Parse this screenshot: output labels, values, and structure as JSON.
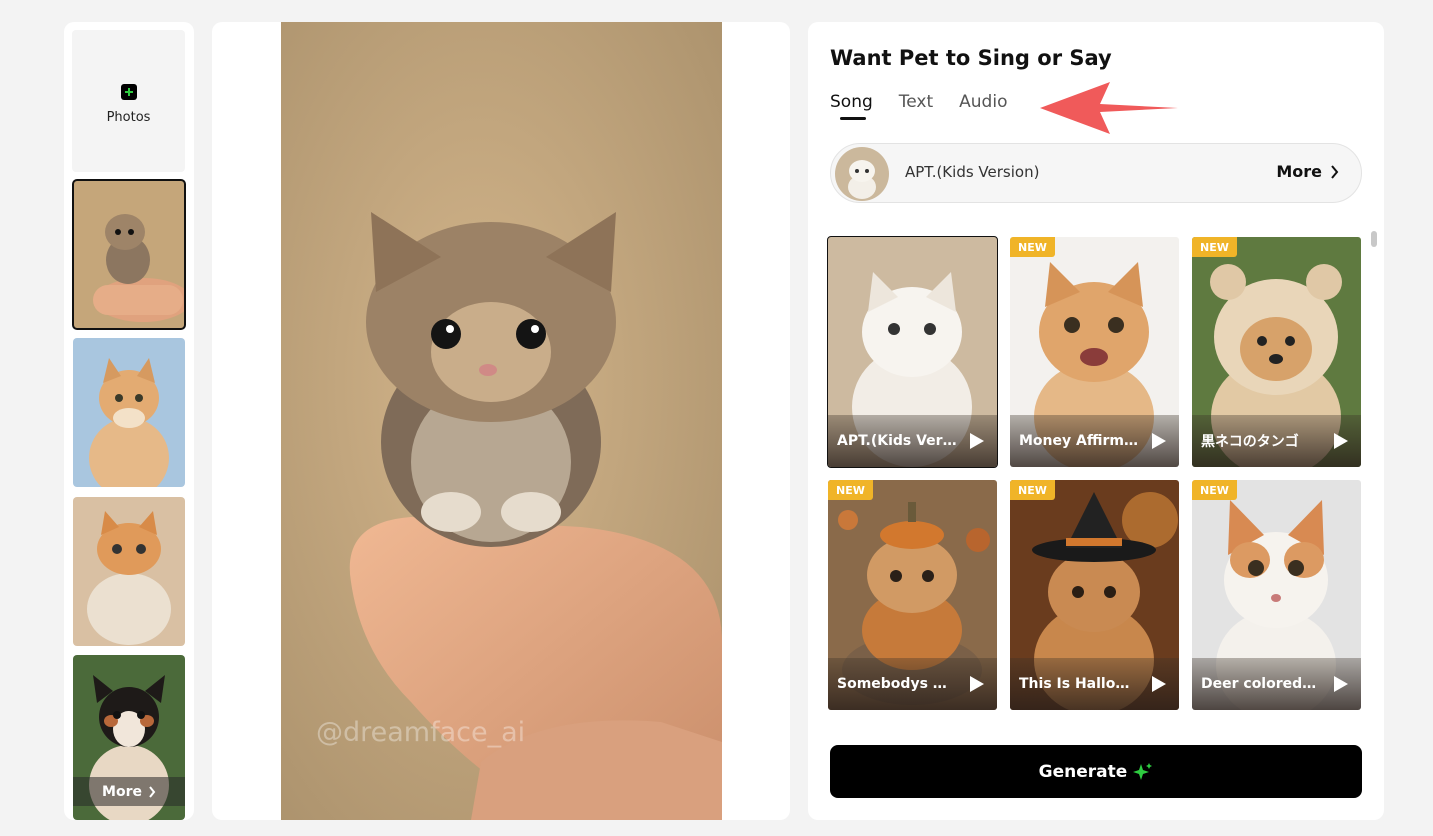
{
  "sidebar": {
    "upload_label": "Photos",
    "more_label": "More"
  },
  "preview": {
    "watermark": "@dreamface_ai"
  },
  "panel": {
    "title": "Want Pet to Sing or Say",
    "tabs": [
      {
        "label": "Song",
        "active": true
      },
      {
        "label": "Text",
        "active": false
      },
      {
        "label": "Audio",
        "active": false
      }
    ],
    "selected_song": "APT.(Kids Version)",
    "more_label": "More",
    "songs": [
      {
        "title": "APT.(Kids Version)",
        "badge": "",
        "selected": true
      },
      {
        "title": "Money Affirmations",
        "badge": "NEW",
        "selected": false
      },
      {
        "title": "黒ネコのタンゴ",
        "badge": "NEW",
        "selected": false
      },
      {
        "title": "Somebodys Watching Me",
        "badge": "NEW",
        "selected": false
      },
      {
        "title": "This Is Halloween",
        "badge": "NEW",
        "selected": false
      },
      {
        "title": "Deer colored cat",
        "badge": "NEW",
        "selected": false
      }
    ],
    "generate_label": "Generate"
  },
  "colors": {
    "accent": "#000000",
    "badge": "#f0b428",
    "arrow": "#f05a5a",
    "sparkle": "#2ecc40"
  }
}
